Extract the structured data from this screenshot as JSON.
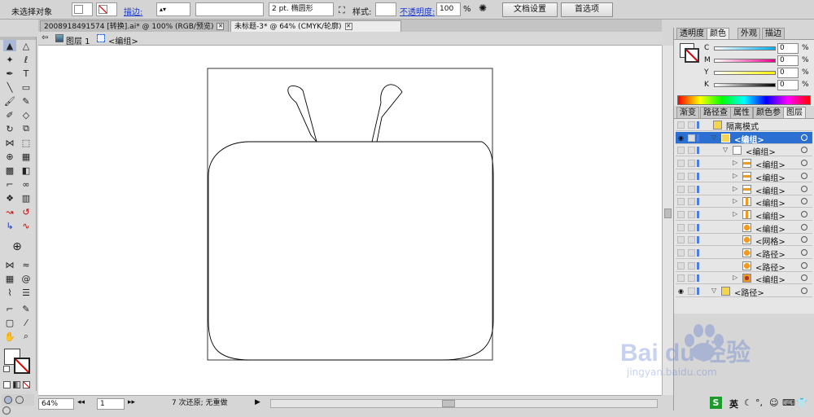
{
  "control_bar": {
    "selection_status": "未选择对象",
    "stroke_label": "描边:",
    "stroke_weight": "2 pt.",
    "brush_label": "椭圆形",
    "style_label": "样式:",
    "opacity_label": "不透明度:",
    "opacity_value": "100",
    "opacity_unit": "%",
    "doc_setup_button": "文档设置",
    "preferences_button": "首选项"
  },
  "doc_tabs": [
    {
      "label": "2008918491574 [转换].ai* @ 100% (RGB/预览)",
      "active": false
    },
    {
      "label": "未标题-3* @ 64% (CMYK/轮廓)",
      "active": true
    }
  ],
  "breadcrumb": {
    "layer": "图层 1",
    "group": "<编组>"
  },
  "status_bar": {
    "zoom": "64%",
    "page": "1",
    "status": "7 次还原; 无重做"
  },
  "color_panel": {
    "tabs": [
      "透明度",
      "颜色",
      "外观",
      "描边"
    ],
    "active_tab": "颜色",
    "channels": [
      {
        "label": "C",
        "value": "0",
        "unit": "%"
      },
      {
        "label": "M",
        "value": "0",
        "unit": "%"
      },
      {
        "label": "Y",
        "value": "0",
        "unit": "%"
      },
      {
        "label": "K",
        "value": "0",
        "unit": "%"
      }
    ]
  },
  "layers_panel": {
    "tabs": [
      "渐变",
      "路径查",
      "属性",
      "颜色参",
      "图层"
    ],
    "active_tab": "图层",
    "rows": [
      {
        "name": "隔离模式",
        "depth": 0,
        "thumb": "folder"
      },
      {
        "name": "<编组>",
        "depth": 1,
        "thumb": "selected",
        "selected": true
      },
      {
        "name": "<编组>",
        "depth": 2,
        "thumb": "empty"
      },
      {
        "name": "<编组>",
        "depth": 3,
        "thumb": "bar-h"
      },
      {
        "name": "<编组>",
        "depth": 3,
        "thumb": "bar-h"
      },
      {
        "name": "<编组>",
        "depth": 3,
        "thumb": "bar-h"
      },
      {
        "name": "<编组>",
        "depth": 3,
        "thumb": "bar-v"
      },
      {
        "name": "<编组>",
        "depth": 3,
        "thumb": "bar-v"
      },
      {
        "name": "<编组>",
        "depth": 3,
        "thumb": "circle"
      },
      {
        "name": "<网格>",
        "depth": 3,
        "thumb": "circle"
      },
      {
        "name": "<路径>",
        "depth": 3,
        "thumb": "circle"
      },
      {
        "name": "<路径>",
        "depth": 3,
        "thumb": "circle"
      },
      {
        "name": "<编组>",
        "depth": 3,
        "thumb": "face"
      },
      {
        "name": "<路径>",
        "depth": 1,
        "thumb": "folder"
      }
    ]
  },
  "taskbar": {
    "ime": "英"
  },
  "watermark": {
    "brand": "Bai du 经验",
    "url": "jingyan.baidu.com"
  },
  "colors": {
    "accent": "#1a39c9",
    "selection": "#2a6fd1",
    "layer_color": "#4a7fe0"
  }
}
